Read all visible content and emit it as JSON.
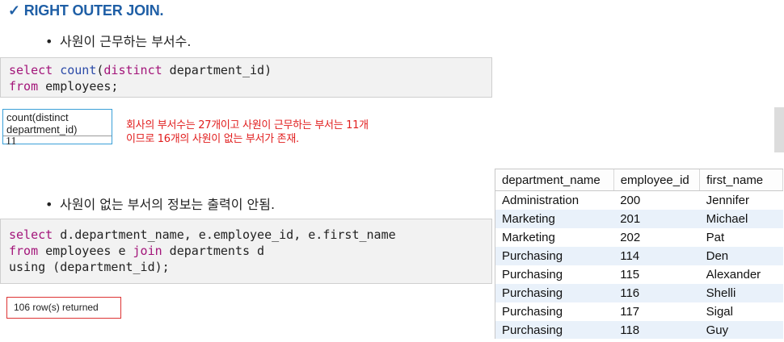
{
  "heading": {
    "check_icon": "✓",
    "text": "RIGHT OUTER JOIN."
  },
  "bullets": {
    "symbol": "•",
    "first": "사원이 근무하는 부서수.",
    "second": "사원이 없는 부서의 정보는 출력이 안됨."
  },
  "query1": {
    "line1": {
      "kw1": "select",
      "fn": "count",
      "open": "(",
      "kw2": "distinct",
      "rest": " department_id)"
    },
    "line2": {
      "kw": "from",
      "rest": " employees;"
    }
  },
  "result1": {
    "header_line1": "count(distinct",
    "header_line2": "department_id)",
    "value": "11"
  },
  "note": {
    "line1": "회사의 부서수는 27개이고 사원이 근무하는 부서는 11개",
    "line2": "이므로 16개의 사원이 없는 부서가 존재."
  },
  "query2": {
    "line1": {
      "kw": "select",
      "rest": " d.department_name, e.employee_id, e.first_name"
    },
    "line2": {
      "kw1": "from",
      "mid": " employees e ",
      "kw2": "join",
      "rest": " departments d"
    },
    "line3": {
      "text": "using (department_id);"
    }
  },
  "rows_returned": "106 row(s) returned",
  "result_grid": {
    "columns": [
      "department_name",
      "employee_id",
      "first_name"
    ],
    "rows": [
      [
        "Administration",
        "200",
        "Jennifer"
      ],
      [
        "Marketing",
        "201",
        "Michael"
      ],
      [
        "Marketing",
        "202",
        "Pat"
      ],
      [
        "Purchasing",
        "114",
        "Den"
      ],
      [
        "Purchasing",
        "115",
        "Alexander"
      ],
      [
        "Purchasing",
        "116",
        "Shelli"
      ],
      [
        "Purchasing",
        "117",
        "Sigal"
      ],
      [
        "Purchasing",
        "118",
        "Guy"
      ]
    ]
  }
}
